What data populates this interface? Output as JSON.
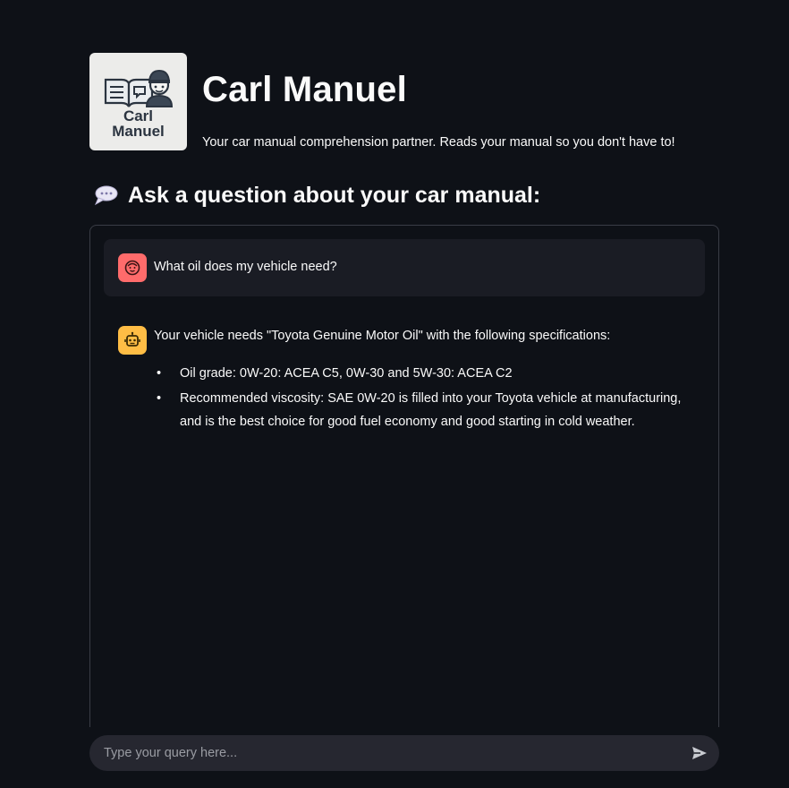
{
  "header": {
    "logo_text_line1": "Carl",
    "logo_text_line2": "Manuel",
    "title": "Carl Manuel",
    "subtitle": "Your car manual comprehension partner. Reads your manual so you don't have to!"
  },
  "section": {
    "icon": "speech-balloon-icon",
    "heading": "Ask a question about your car manual:"
  },
  "chat": {
    "messages": [
      {
        "role": "user",
        "avatar_icon": "smiley-face-icon",
        "avatar_color": "#ff6b6b",
        "text": "What oil does my vehicle need?"
      },
      {
        "role": "assistant",
        "avatar_icon": "robot-icon",
        "avatar_color": "#ffbd45",
        "text": "Your vehicle needs \"Toyota Genuine Motor Oil\" with the following specifications:",
        "bullets": [
          "Oil grade: 0W-20: ACEA C5, 0W-30 and 5W-30: ACEA C2",
          "Recommended viscosity: SAE 0W-20 is filled into your Toyota vehicle at manufacturing, and is the best choice for good fuel economy and good starting in cold weather."
        ]
      }
    ]
  },
  "input": {
    "placeholder": "Type your query here...",
    "value": "",
    "send_icon": "send-arrow-icon"
  },
  "colors": {
    "background": "#0e1117",
    "user_avatar": "#ff6b6b",
    "bot_avatar": "#ffbd45",
    "user_bubble": "#1a1c24",
    "input_bg": "#262730"
  }
}
